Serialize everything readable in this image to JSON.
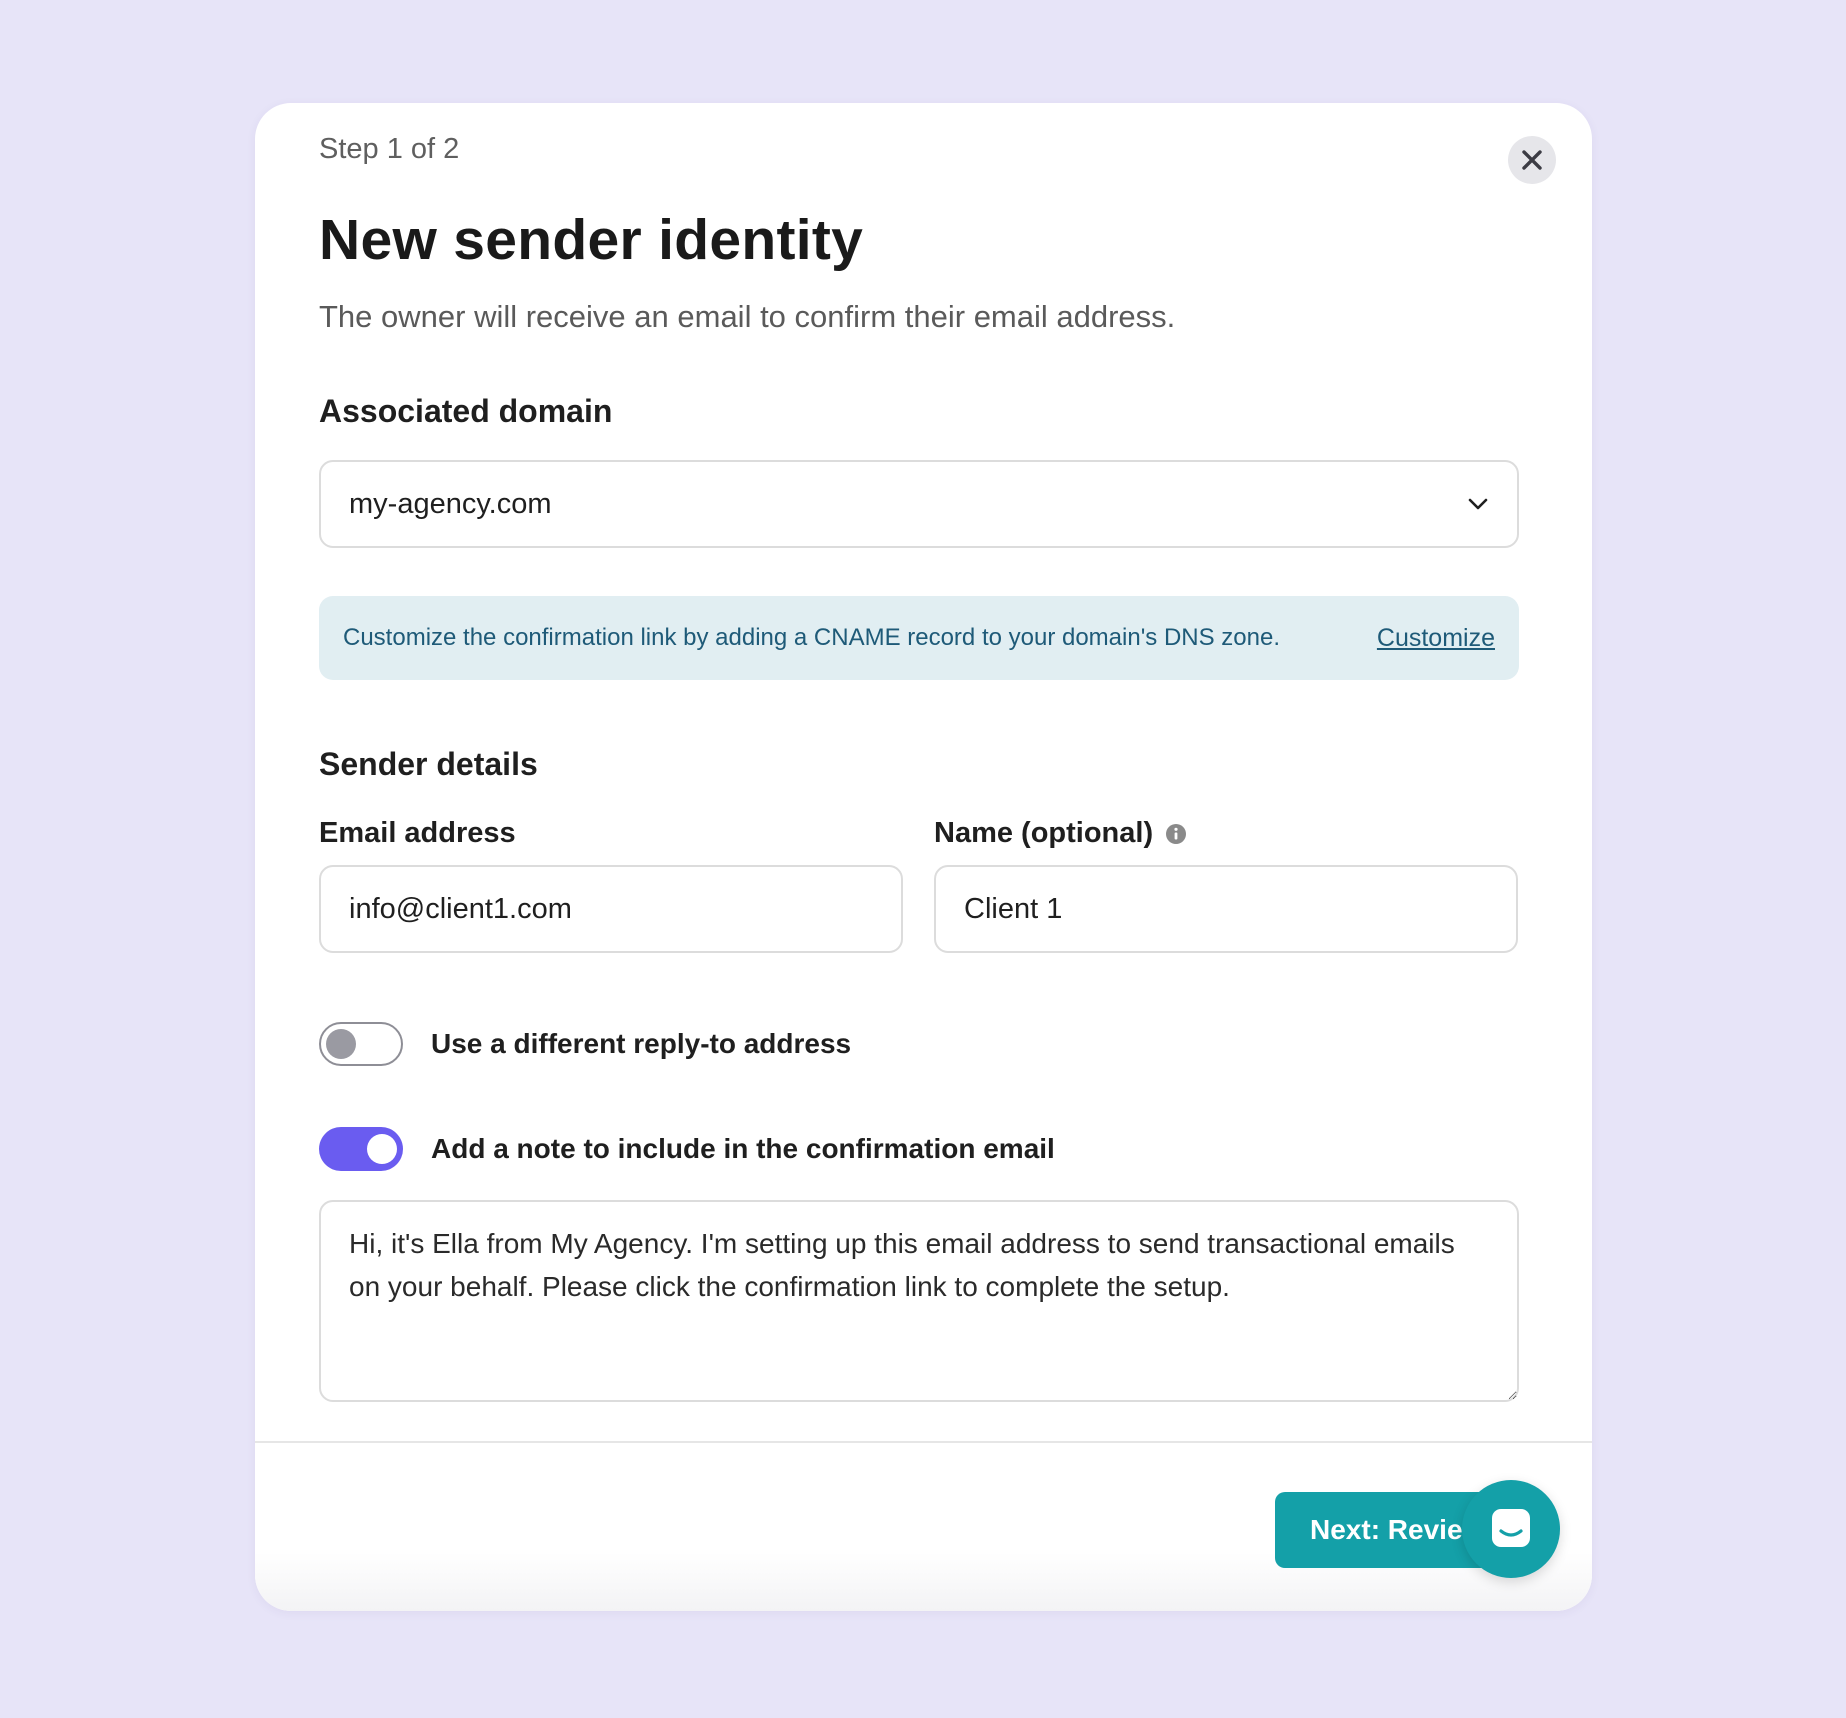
{
  "modal": {
    "step": "Step 1 of 2",
    "title": "New sender identity",
    "subtitle": "The owner will receive an email to confirm their email address."
  },
  "domain": {
    "label": "Associated domain",
    "selected": "my-agency.com"
  },
  "banner": {
    "text": "Customize the confirmation link by adding a CNAME record to your domain's DNS zone.",
    "link": "Customize"
  },
  "sender": {
    "heading": "Sender details",
    "email_label": "Email address",
    "email_value": "info@client1.com",
    "name_label": "Name (optional)",
    "name_value": "Client 1"
  },
  "toggles": {
    "reply_to": {
      "label": "Use a different reply-to address",
      "on": false
    },
    "note": {
      "label": "Add a note to include in the confirmation email",
      "on": true
    }
  },
  "note_text": "Hi, it's Ella from My Agency. I'm setting up this email address to send transactional emails on your behalf. Please click the confirmation link to complete the setup.",
  "footer": {
    "next_label": "Next: Review"
  },
  "colors": {
    "background": "#e7e4f8",
    "accent": "#6a5cf0",
    "primary_button": "#14a0a8",
    "banner_bg": "#e1eef2",
    "banner_text": "#1e5a78"
  },
  "icons": [
    "close-icon",
    "chevron-down-icon",
    "info-icon",
    "chat-icon"
  ]
}
